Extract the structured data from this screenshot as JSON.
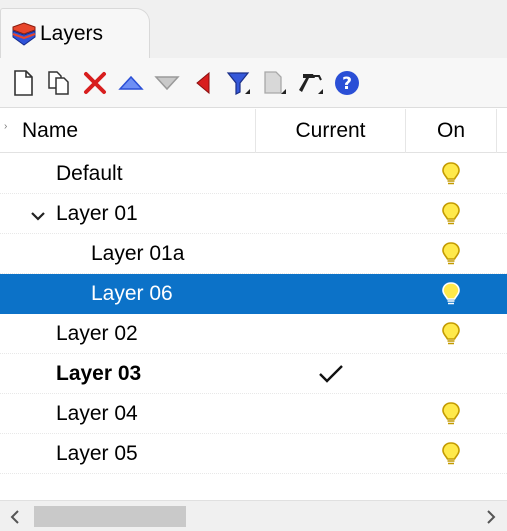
{
  "panel": {
    "tab_label": "Layers",
    "tab_icon": "layers-panel-icon"
  },
  "toolbar": {
    "buttons": [
      {
        "icon": "new-layer-icon",
        "tooltip": ""
      },
      {
        "icon": "new-sublayer-icon",
        "tooltip": ""
      },
      {
        "icon": "delete-icon",
        "tooltip": ""
      },
      {
        "icon": "move-up-icon",
        "tooltip": ""
      },
      {
        "icon": "move-down-icon",
        "tooltip": ""
      },
      {
        "icon": "move-to-parent-icon",
        "tooltip": ""
      },
      {
        "icon": "filter-icon",
        "tooltip": ""
      },
      {
        "icon": "layer-states-icon",
        "tooltip": ""
      },
      {
        "icon": "tools-icon",
        "tooltip": ""
      },
      {
        "icon": "help-icon",
        "tooltip": ""
      }
    ]
  },
  "columns": {
    "name": "Name",
    "current": "Current",
    "on": "On"
  },
  "layers": [
    {
      "name": "Default",
      "indent": 0,
      "expandable": false,
      "bold": false,
      "current": false,
      "on": true,
      "selected": false
    },
    {
      "name": "Layer 01",
      "indent": 0,
      "expandable": true,
      "bold": false,
      "current": false,
      "on": true,
      "selected": false
    },
    {
      "name": "Layer 01a",
      "indent": 1,
      "expandable": false,
      "bold": false,
      "current": false,
      "on": true,
      "selected": false
    },
    {
      "name": "Layer 06",
      "indent": 1,
      "expandable": false,
      "bold": false,
      "current": false,
      "on": true,
      "selected": true
    },
    {
      "name": "Layer 02",
      "indent": 0,
      "expandable": false,
      "bold": false,
      "current": false,
      "on": true,
      "selected": false
    },
    {
      "name": "Layer 03",
      "indent": 0,
      "expandable": false,
      "bold": true,
      "current": true,
      "on": false,
      "selected": false
    },
    {
      "name": "Layer 04",
      "indent": 0,
      "expandable": false,
      "bold": false,
      "current": false,
      "on": true,
      "selected": false
    },
    {
      "name": "Layer 05",
      "indent": 0,
      "expandable": false,
      "bold": false,
      "current": false,
      "on": true,
      "selected": false
    }
  ],
  "colors": {
    "selection": "#0c72c8",
    "bulb_fill": "#ffe94a",
    "bulb_outline": "#c39a00",
    "delete_red": "#d81e1e",
    "arrow_blue": "#2a4fd6",
    "help_blue": "#2a4fd6"
  }
}
